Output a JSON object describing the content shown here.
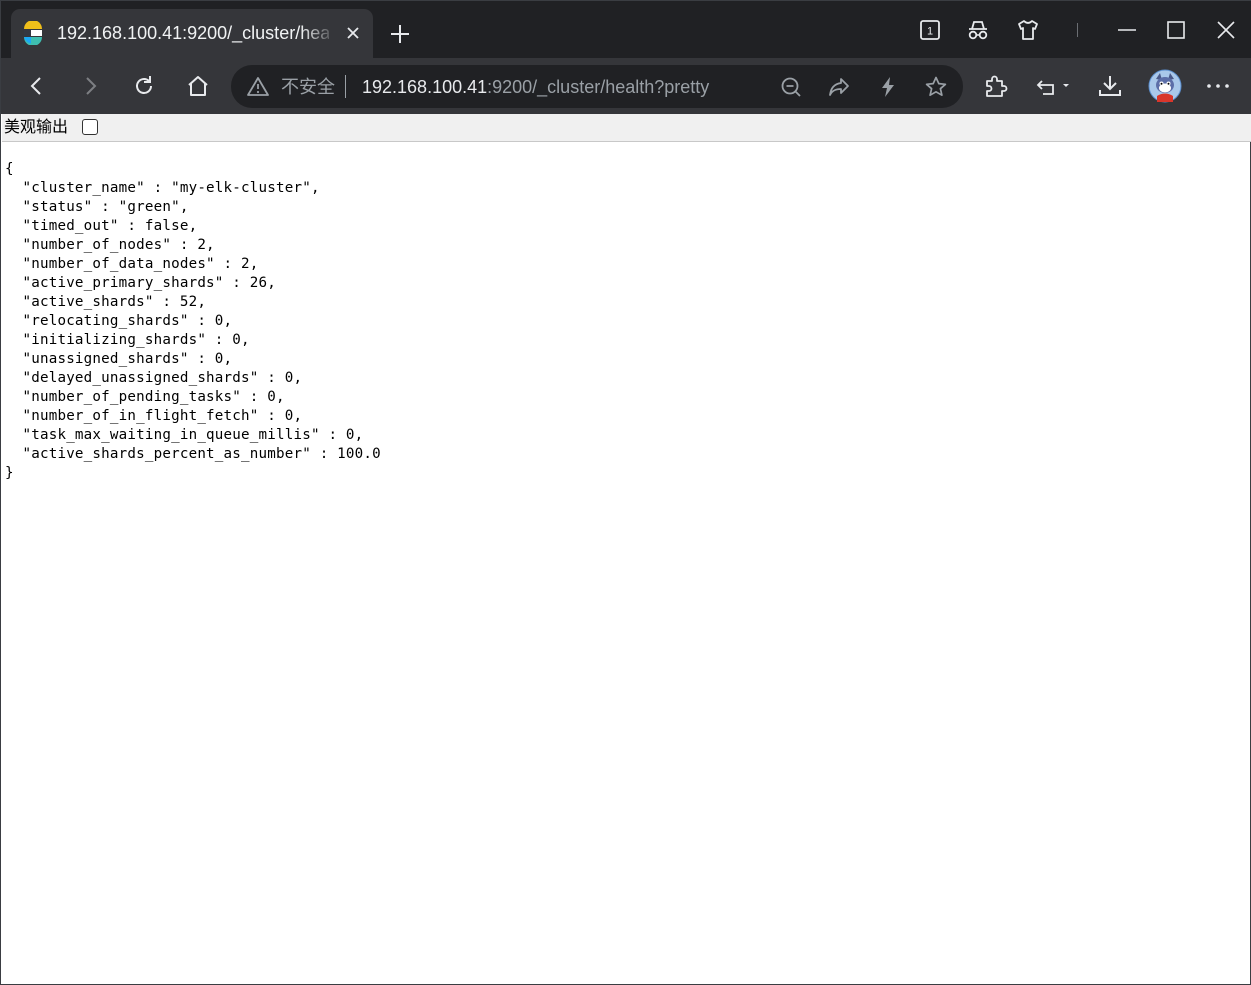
{
  "tab": {
    "title": "192.168.100.41:9200/_cluster/health?pretty"
  },
  "toolbar": {
    "insecure_label": "不安全",
    "url_host": "192.168.100.41",
    "url_path": ":9200/_cluster/health?pretty",
    "tab_count": "1"
  },
  "pretty_print": {
    "label": "美观输出",
    "checked": false
  },
  "json_lines": [
    "{",
    "  \"cluster_name\" : \"my-elk-cluster\",",
    "  \"status\" : \"green\",",
    "  \"timed_out\" : false,",
    "  \"number_of_nodes\" : 2,",
    "  \"number_of_data_nodes\" : 2,",
    "  \"active_primary_shards\" : 26,",
    "  \"active_shards\" : 52,",
    "  \"relocating_shards\" : 0,",
    "  \"initializing_shards\" : 0,",
    "  \"unassigned_shards\" : 0,",
    "  \"delayed_unassigned_shards\" : 0,",
    "  \"number_of_pending_tasks\" : 0,",
    "  \"number_of_in_flight_fetch\" : 0,",
    "  \"task_max_waiting_in_queue_millis\" : 0,",
    "  \"active_shards_percent_as_number\" : 100.0",
    "}"
  ],
  "icons": {
    "favicon": "elastic-logo-icon",
    "tab_close": "close-icon",
    "new_tab": "plus-icon",
    "tab_actions": "tab-counter-icon",
    "incognito": "incognito-icon",
    "extensions_shirt": "shirt-icon",
    "minimize": "minimize-icon",
    "maximize": "maximize-icon",
    "close_window": "close-icon",
    "back": "arrow-left-icon",
    "forward": "arrow-right-icon",
    "reload": "reload-icon",
    "home": "home-icon",
    "warning": "warning-icon",
    "zoom": "zoom-out-icon",
    "share": "share-icon",
    "lightning": "lightning-icon",
    "bookmark": "star-icon",
    "extension": "puzzle-icon",
    "undo": "undo-icon",
    "download": "download-icon",
    "profile": "avatar",
    "menu": "more-icon"
  },
  "colors": {
    "title_bar": "#202124",
    "toolbar": "#35363a",
    "omnibox": "#202124",
    "page_background": "#ffffff"
  }
}
